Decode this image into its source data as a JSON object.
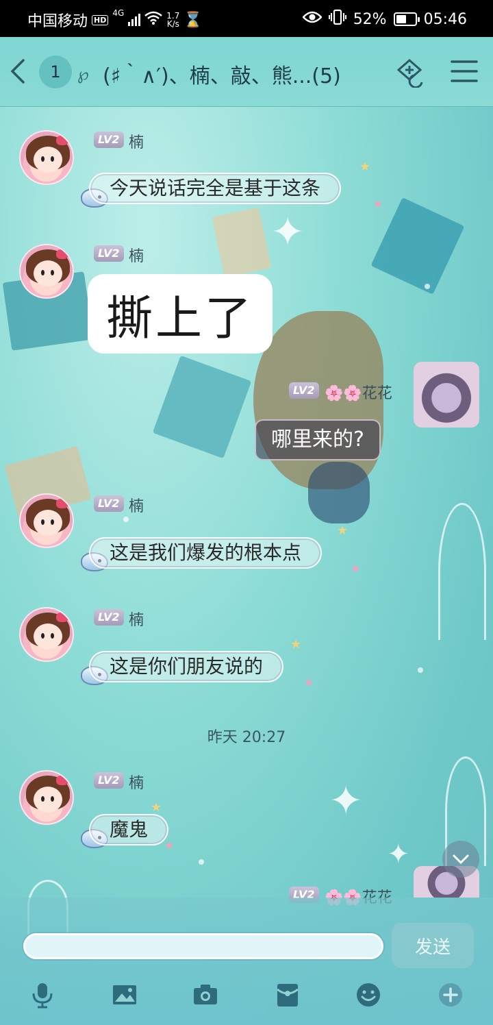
{
  "status_bar": {
    "carrier": "中国移动",
    "hd": "HD",
    "net_gen": "4G",
    "speed_value": "1.7",
    "speed_unit": "K/s",
    "battery_pct": "52%",
    "time": "05:46"
  },
  "header": {
    "unread_count": "1",
    "title": "(♯｀∧′)、楠、敲、熊...(5)"
  },
  "messages": [
    {
      "sender": "楠",
      "level": "LV2",
      "text": "今天说话完全是基于这条"
    },
    {
      "sender": "楠",
      "level": "LV2",
      "sticker_text": "撕上了"
    },
    {
      "sender": "🌸🌸花花",
      "level": "LV2",
      "text": "哪里来的?"
    },
    {
      "sender": "楠",
      "level": "LV2",
      "text": "这是我们爆发的根本点"
    },
    {
      "sender": "楠",
      "level": "LV2",
      "text": "这是你们朋友说的"
    },
    {
      "timestamp": "昨天 20:27"
    },
    {
      "sender": "楠",
      "level": "LV2",
      "text": "魔鬼"
    },
    {
      "sender": "🌸🌸花花",
      "level": "LV2"
    }
  ],
  "input": {
    "value": "",
    "send_label": "发送"
  },
  "toolbar_icons": [
    "microphone-icon",
    "image-icon",
    "camera-icon",
    "red-packet-icon",
    "emoji-icon",
    "plus-icon"
  ]
}
